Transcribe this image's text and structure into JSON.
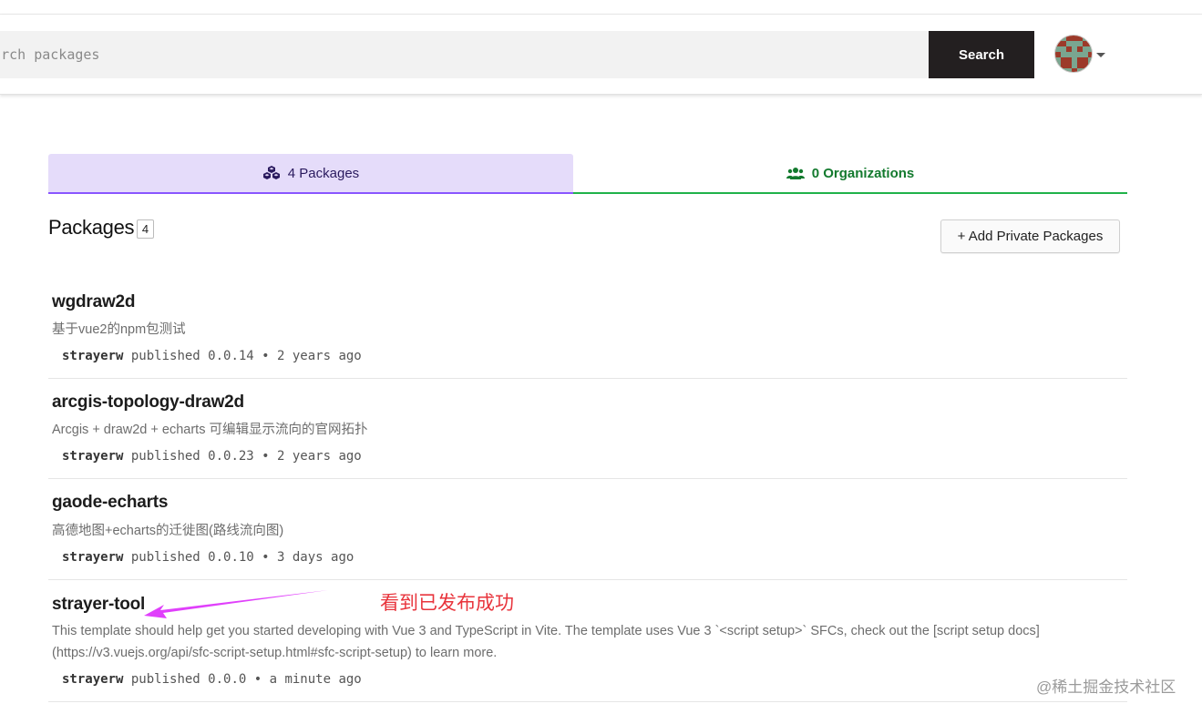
{
  "header": {
    "search_placeholder": "Search packages",
    "search_button": "Search"
  },
  "tabs": [
    {
      "label": "4 Packages",
      "icon": "cubes-icon"
    },
    {
      "label": "0 Organizations",
      "icon": "users-icon"
    }
  ],
  "section": {
    "title": "Packages",
    "count": "4",
    "add_button": "+ Add Private Packages"
  },
  "packages": [
    {
      "name": "wgdraw2d",
      "description": "基于vue2的npm包测试",
      "author": "strayerw",
      "published_text": "published 0.0.14 • 2 years ago"
    },
    {
      "name": "arcgis-topology-draw2d",
      "description": "Arcgis + draw2d + echarts 可编辑显示流向的官网拓扑",
      "author": "strayerw",
      "published_text": "published 0.0.23 • 2 years ago"
    },
    {
      "name": "gaode-echarts",
      "description": "高德地图+echarts的迁徙图(路线流向图)",
      "author": "strayerw",
      "published_text": "published 0.0.10 • 3 days ago"
    },
    {
      "name": "strayer-tool",
      "description": "This template should help get you started developing with Vue 3 and TypeScript in Vite. The template uses Vue 3 `<script setup>` SFCs, check out the [script setup docs](https://v3.vuejs.org/api/sfc-script-setup.html#sfc-script-setup) to learn more.",
      "author": "strayerw",
      "published_text": "published 0.0.0 • a minute ago"
    }
  ],
  "annotation": {
    "text": "看到已发布成功",
    "color": "#e8343c"
  },
  "watermark": "@稀土掘金技术社区",
  "colors": {
    "packages_tab_bg": "#e5dcfa",
    "packages_tab_accent": "#8956ff",
    "orgs_tab_accent": "#20b24a",
    "search_button_bg": "#231f20",
    "arrow": "#e040fb"
  }
}
